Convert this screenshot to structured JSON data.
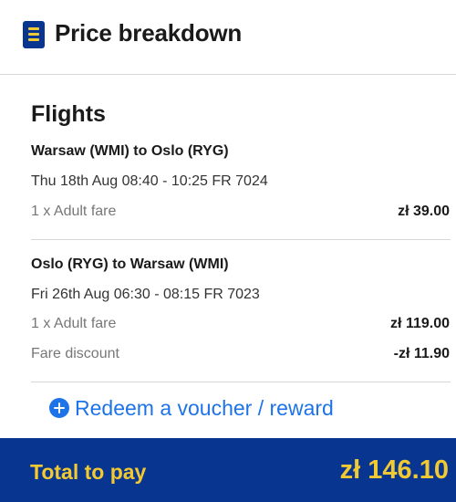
{
  "header": {
    "icon": "receipt-icon",
    "title": "Price breakdown"
  },
  "flights": {
    "title": "Flights",
    "legs": [
      {
        "route": "Warsaw (WMI) to Oslo (RYG)",
        "details": "Thu 18th Aug 08:40 - 10:25 FR 7024",
        "fares": [
          {
            "label": "1 x Adult fare",
            "amount": "zł 39.00"
          }
        ]
      },
      {
        "route": "Oslo (RYG) to Warsaw (WMI)",
        "details": "Fri 26th Aug 06:30 - 08:15 FR 7023",
        "fares": [
          {
            "label": "1 x Adult fare",
            "amount": "zł 119.00"
          },
          {
            "label": "Fare discount",
            "amount": "-zł 11.90"
          }
        ]
      }
    ]
  },
  "voucher": {
    "icon": "plus-circle-icon",
    "label": "Redeem a voucher / reward"
  },
  "total": {
    "label": "Total to pay",
    "amount": "zł 146.10"
  },
  "colors": {
    "brand_blue": "#073590",
    "brand_yellow": "#f1c933",
    "link_blue": "#1e73e8"
  }
}
